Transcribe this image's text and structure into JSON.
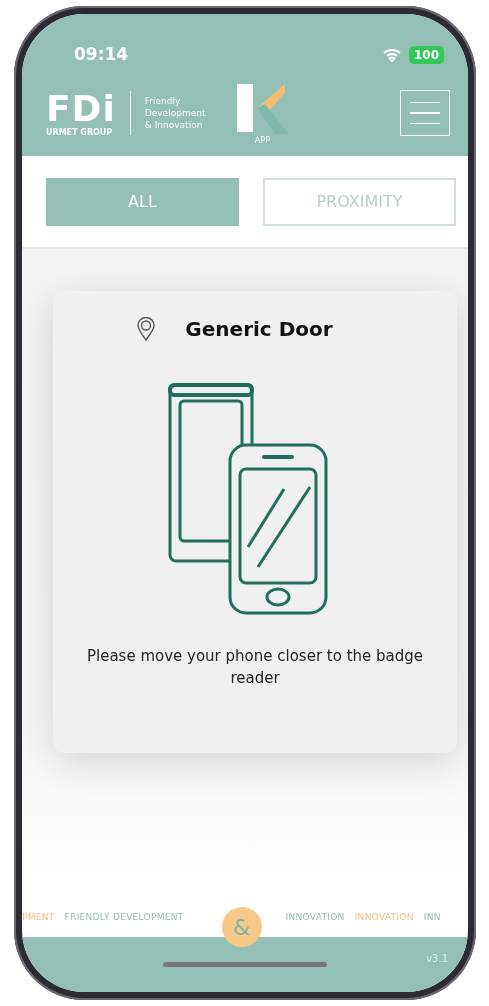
{
  "status_bar": {
    "time": "09:14",
    "battery": "100"
  },
  "header": {
    "logo_mark": "FDi",
    "logo_group": "URMET GROUP",
    "tagline": [
      "Friendly",
      "Development",
      "& Innovation"
    ],
    "app_label": "APP"
  },
  "tabs": [
    {
      "label": "ALL",
      "selected": true
    },
    {
      "label": "PROXIMITY",
      "selected": false
    }
  ],
  "dialog": {
    "title": "Generic Door",
    "message": "Please move your phone closer to the badge reader"
  },
  "footer": {
    "marquee_left": [
      {
        "text": "PMENT",
        "color": "#f2c27d"
      },
      {
        "text": "FRIENDLY DEVELOPMENT",
        "color": "#8fbdb4"
      }
    ],
    "ampersand": "&",
    "marquee_right": [
      {
        "text": "INNOVATION",
        "color": "#8fbdb4"
      },
      {
        "text": "INNOVATION",
        "color": "#f2c27d"
      },
      {
        "text": "INN",
        "color": "#8fbdb4"
      }
    ],
    "version": "v3.1"
  }
}
